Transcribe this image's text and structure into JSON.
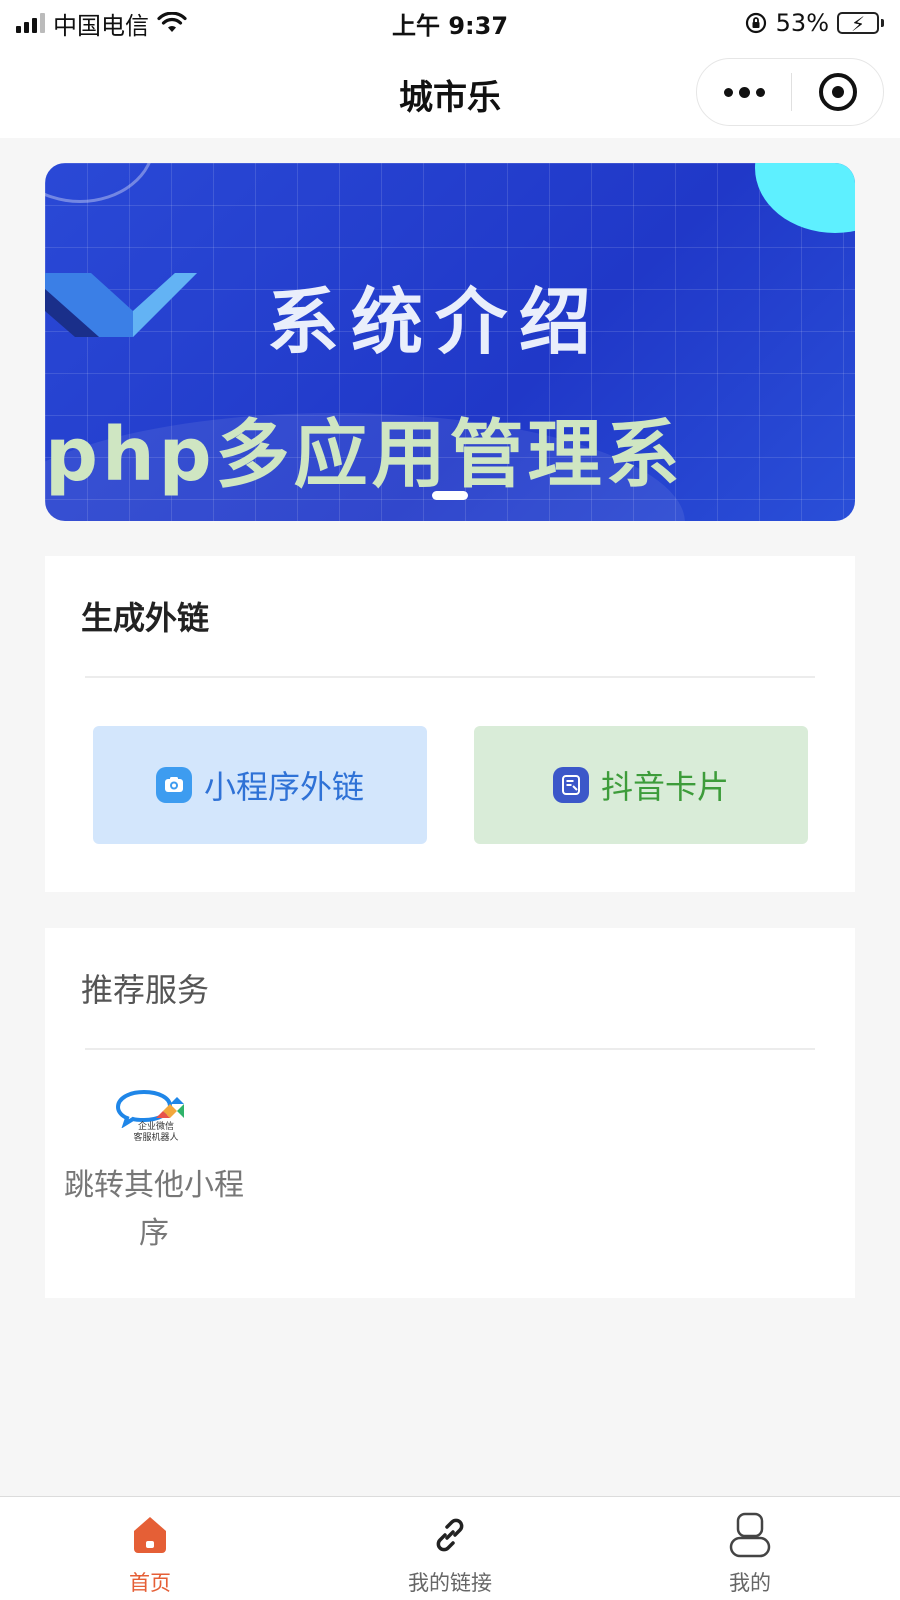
{
  "status_bar": {
    "carrier": "中国电信",
    "time": "上午 9:37",
    "battery": "53%",
    "battery_level": 0.53
  },
  "nav": {
    "title": "城市乐"
  },
  "banner": {
    "headline": "系统介绍",
    "subline": "php多应用管理系",
    "slide_count": 1,
    "active_slide": 0
  },
  "external_link_section": {
    "title": "生成外链",
    "buttons": [
      {
        "label": "小程序外链",
        "icon": "camera-icon",
        "color": "#2f72d6"
      },
      {
        "label": "抖音卡片",
        "icon": "card-icon",
        "color": "#3d9c3a"
      }
    ]
  },
  "recommend_section": {
    "title": "推荐服务",
    "items": [
      {
        "label": "跳转其他小程序",
        "logo_text_1": "企业微信",
        "logo_text_2": "客服机器人",
        "icon": "wecom-robot-icon"
      }
    ]
  },
  "tab_bar": {
    "tabs": [
      {
        "label": "首页",
        "icon": "home-icon",
        "active": true
      },
      {
        "label": "我的链接",
        "icon": "link-icon",
        "active": false
      },
      {
        "label": "我的",
        "icon": "user-icon",
        "active": false
      }
    ],
    "accent_color": "#e55f36"
  }
}
